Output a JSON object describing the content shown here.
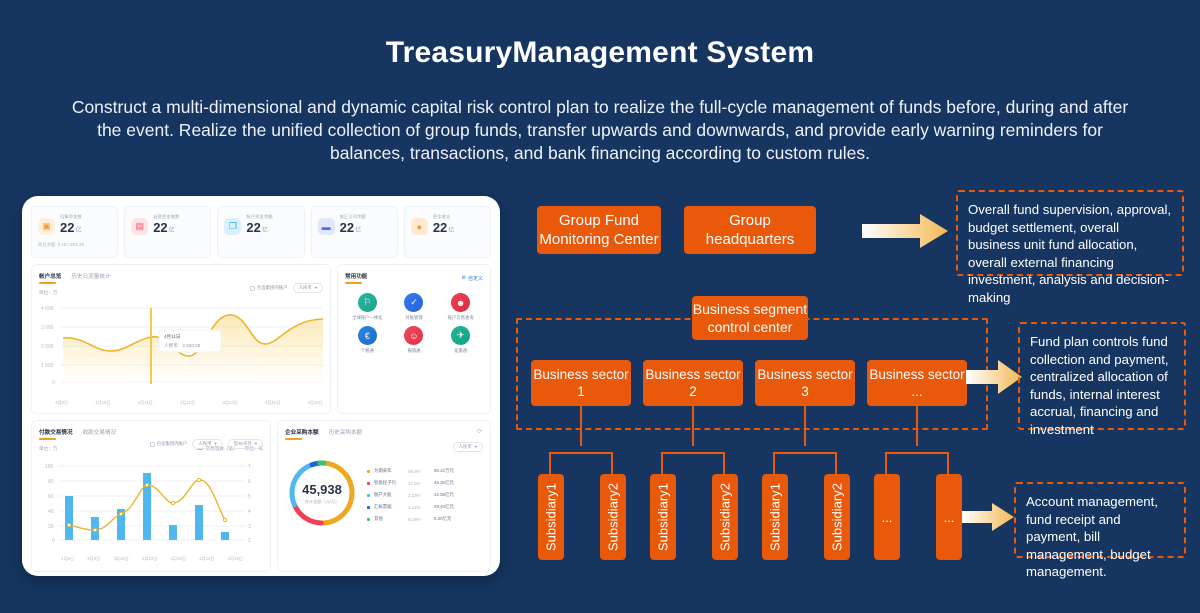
{
  "header": {
    "title": "TreasuryManagement System",
    "subtitle": "Construct a multi-dimensional and dynamic capital risk control plan to realize the full-cycle management of funds before, during and after the event. Realize the unified collection of group funds, transfer upwards and downwards, and provide early warning reminders for balances, transactions, and bank financing according to custom rules."
  },
  "colors": {
    "background": "#163560",
    "accent_orange": "#e8590c",
    "arrow_gold": "#f5be5e",
    "chart_yellow": "#f0b429",
    "chart_blue": "#4fb8ef"
  },
  "diagram": {
    "group_fund_monitoring_center": "Group Fund\nMonitoring Center",
    "group_fund_monitoring_center_line1": "Group Fund",
    "group_fund_monitoring_center_line2": "Monitoring Center",
    "group_headquarters_line1": "Group",
    "group_headquarters_line2": "headquarters",
    "business_segment_line1": "Business segment",
    "business_segment_line2": "control center",
    "sectors": [
      {
        "line1": "Business sector",
        "line2": "1"
      },
      {
        "line1": "Business sector",
        "line2": "2"
      },
      {
        "line1": "Business sector",
        "line2": "3"
      },
      {
        "line1": "Business sector",
        "line2": "..."
      }
    ],
    "subsidiaries": [
      "Subsidiary1",
      "Subsidiary2",
      "Subsidiary1",
      "Subsidiary2",
      "Subsidiary1",
      "Subsidiary2",
      "...",
      "..."
    ],
    "notes": [
      "Overall fund supervision, approval, budget settlement, overall business unit fund allocation, overall external financing investment, analysis and decision-making",
      "Fund plan controls fund collection and payment, centralized allocation of funds, internal interest accrual, financing and investment",
      "Account management, fund receipt and payment, bill management, budget management."
    ]
  },
  "dashboard": {
    "kpis": [
      {
        "label": "归集资金数",
        "value": "22",
        "unit": "亿",
        "sub": "昨日余额  ￥287,863.20",
        "icon": "wallet-icon",
        "icon_bg": "#fff0dc",
        "icon_fg": "#f59f2a"
      },
      {
        "label": "自营资金笔数",
        "value": "22",
        "unit": "亿",
        "sub": "",
        "icon": "briefcase-icon",
        "icon_bg": "#ffe4e6",
        "icon_fg": "#f4566c"
      },
      {
        "label": "帐户资金余额",
        "value": "22",
        "unit": "亿",
        "sub": "",
        "icon": "layers-icon",
        "icon_bg": "#d9f1fd",
        "icon_fg": "#2eaae0"
      },
      {
        "label": "电汇公司余额",
        "value": "22",
        "unit": "亿",
        "sub": "",
        "icon": "card-icon",
        "icon_bg": "#e2e8fb",
        "icon_fg": "#4f6ee0"
      },
      {
        "label": "资金收支",
        "value": "22",
        "unit": "亿",
        "sub": "",
        "icon": "piggy-icon",
        "icon_bg": "#ffe9d2",
        "icon_fg": "#f5923e"
      }
    ],
    "line_card": {
      "tab_active": "帐户总览",
      "tab_inactive": "历史日流量统计",
      "checkbox_label": "包含集团内账户",
      "select_value": "人民币",
      "unit_label": "单位：万",
      "tooltip_title": "4月11日",
      "tooltip_line": "人民币：2,920.06"
    },
    "apps_card": {
      "title": "常用功能",
      "action": "自定义",
      "apps": [
        {
          "label": "全球账户一体化",
          "icon": "flag-icon",
          "bg1": "#2fb5a0",
          "bg2": "#19a58e",
          "glyph": "F"
        },
        {
          "label": "对账管理",
          "icon": "doc-check-icon",
          "bg1": "#3a7bf0",
          "bg2": "#2462da",
          "glyph": "Z"
        },
        {
          "label": "账户交易查询",
          "icon": "person-icon",
          "bg1": "#ef4056",
          "bg2": "#d92b42",
          "glyph": "P"
        },
        {
          "label": "个税通",
          "icon": "euro-icon",
          "bg1": "#2f86e0",
          "bg2": "#1b6ec6",
          "glyph": "E"
        },
        {
          "label": "报销通",
          "icon": "face-icon",
          "bg1": "#f2495c",
          "bg2": "#dc3347",
          "glyph": "R"
        },
        {
          "label": "差旅通",
          "icon": "plane-icon",
          "bg1": "#21b79a",
          "bg2": "#12a184",
          "glyph": "T"
        }
      ]
    },
    "bar_card": {
      "tab_active": "付款交易情况",
      "tab_inactive": "收款交易情况",
      "checkbox_label": "包含集团内账户",
      "select_currency": "人民币",
      "select_period": "近30天付",
      "unit_left": "单位：万",
      "unit_right": "单位：笔",
      "legend": "交易笔数（笔）"
    },
    "donut_card": {
      "tab_active": "企业采购本额",
      "tab_inactive": "历史采购本额",
      "select_value": "人民币",
      "center_value": "45,938",
      "center_caption": "合计金额（元/月）"
    }
  },
  "chart_data": [
    {
      "type": "line",
      "title": "帐户总览",
      "xlabel": "",
      "ylabel": "单位：万",
      "x": [
        "4月9日",
        "4月10日",
        "4月11日",
        "4月12日",
        "4月13日",
        "4月14日",
        "4月15日"
      ],
      "categories": [
        "4月9日",
        "4月10日",
        "4月11日",
        "4月12日",
        "4月13日",
        "4月14日",
        "4月15日"
      ],
      "series": [
        {
          "name": "人民币",
          "values": [
            2400,
            1800,
            2500,
            1600,
            3800,
            2200,
            3500
          ]
        }
      ],
      "ylim": [
        0,
        4000
      ],
      "yticks": [
        0,
        1000,
        2000,
        3000,
        4000
      ],
      "ytick_labels": [
        "0",
        "1 000",
        "2 000",
        "3 000",
        "4 000"
      ],
      "grid": true,
      "legend": "none",
      "annotation": {
        "x": "4月11日",
        "title": "4月11日",
        "text": "人民币：2,920.06"
      }
    },
    {
      "type": "bar",
      "title": "付款交易情况",
      "xlabel": "",
      "ylabel": "单位：万",
      "categories": [
        "4月8日",
        "4月9日",
        "4月10日",
        "4月12日",
        "4月13日",
        "4月14日",
        "4月15日"
      ],
      "series": [
        {
          "name": "金额（万）",
          "type": "bar",
          "values": [
            60,
            32,
            42,
            90,
            20,
            47,
            10
          ]
        },
        {
          "name": "交易笔数（笔）",
          "type": "line",
          "values": [
            2,
            1,
            3,
            5,
            3,
            6,
            2
          ]
        }
      ],
      "ylim": [
        0,
        100
      ],
      "yticks": [
        0,
        20,
        40,
        60,
        80,
        100
      ],
      "ytick_labels": [
        "0",
        "20",
        "40",
        "60",
        "80",
        "100"
      ],
      "y2lim": [
        0,
        7
      ],
      "y2tick_labels": [
        "7",
        "6",
        "5",
        "4",
        "3",
        "2"
      ],
      "grid": true,
      "legend": "top-right"
    },
    {
      "type": "pie",
      "title": "企业采购本额",
      "center_value": "45,938",
      "center_caption": "合计金额（元/月）",
      "labels": [
        "为期采年",
        "智能程子包",
        "税产大股",
        "汇帐票据",
        "其他"
      ],
      "percents": [
        "49.3%",
        "17.5%",
        "2.23%",
        "4.12%",
        "9.18%"
      ],
      "values": [
        "90.22万元",
        "48.30亿元",
        "42.08亿元",
        "29.40亿元",
        "5.30亿元"
      ],
      "colors": [
        "#f0a820",
        "#ef4056",
        "#4fb8ef",
        "#2462da",
        "#35c36e"
      ],
      "legend": "right"
    }
  ]
}
